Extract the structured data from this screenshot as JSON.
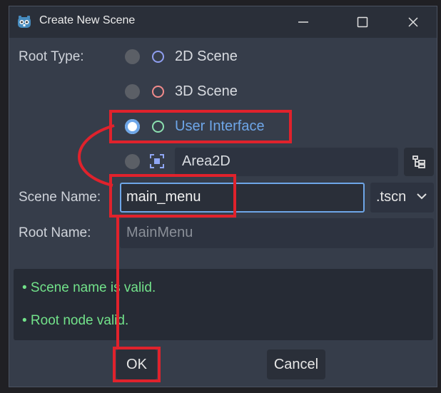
{
  "window": {
    "title": "Create New Scene",
    "minimize_icon": "minimize-icon",
    "maximize_icon": "maximize-icon",
    "close_icon": "close-icon"
  },
  "form": {
    "root_type_label": "Root Type:",
    "options": [
      {
        "label": "2D Scene",
        "selected": false,
        "color": "#8f9ef0"
      },
      {
        "label": "3D Scene",
        "selected": false,
        "color": "#f18b8b"
      },
      {
        "label": "User Interface",
        "selected": true,
        "color": "#8ce0b0"
      },
      {
        "label": "Area2D",
        "selected": false,
        "color": "#8fa6f5"
      }
    ],
    "pick_node_icon": "node-tree-icon",
    "scene_name_label": "Scene Name:",
    "scene_name_value": "main_menu",
    "extension": ".tscn",
    "root_name_label": "Root Name:",
    "root_name_placeholder": "MainMenu"
  },
  "messages": [
    "•  Scene name is valid.",
    "•  Root node valid."
  ],
  "buttons": {
    "ok": "OK",
    "cancel": "Cancel"
  },
  "colors": {
    "accent": "#6ea6e8",
    "valid": "#72e28a",
    "annotation": "#e0222c"
  }
}
